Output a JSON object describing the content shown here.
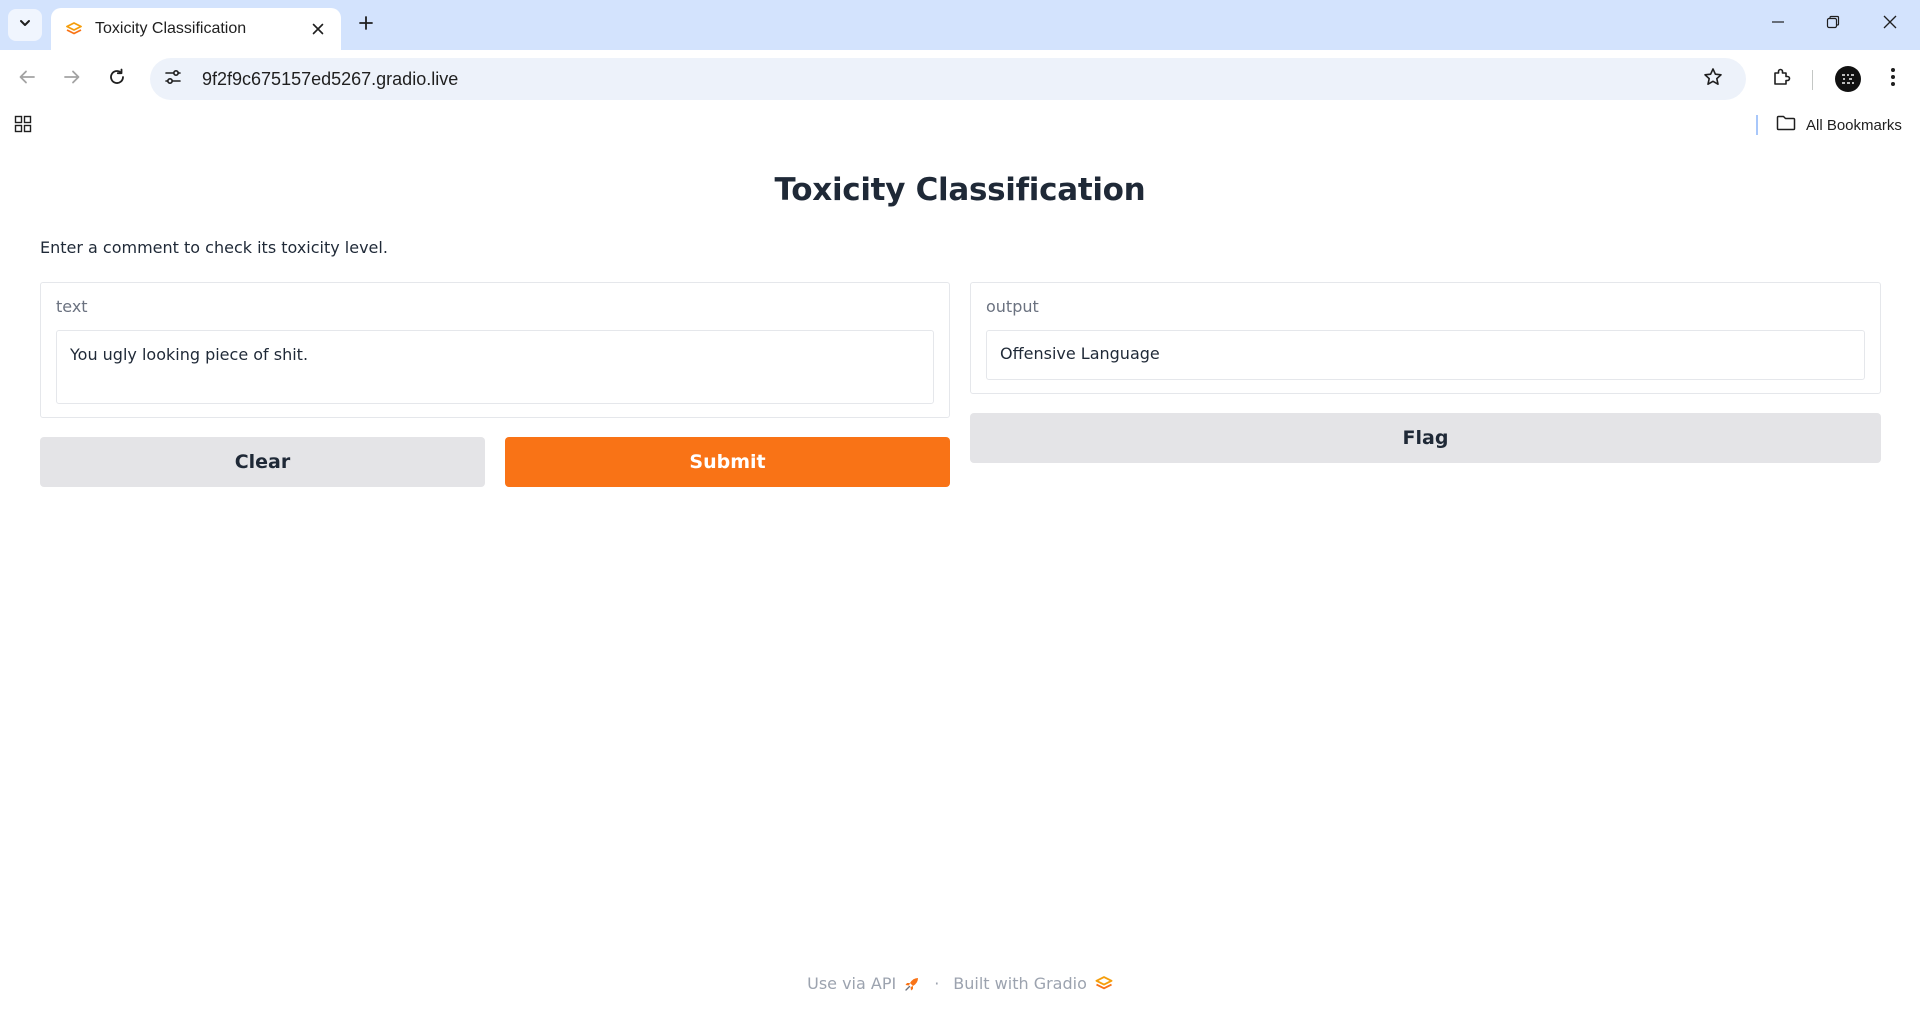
{
  "browser": {
    "tab": {
      "title": "Toxicity Classification"
    },
    "address_bar": {
      "url": "9f2f9c675157ed5267.gradio.live"
    },
    "bookmarks_bar": {
      "all_bookmarks_label": "All Bookmarks"
    }
  },
  "app": {
    "title": "Toxicity Classification",
    "description": "Enter a comment to check its toxicity level.",
    "input": {
      "label": "text",
      "value": "You ugly looking piece of shit."
    },
    "output": {
      "label": "output",
      "value": "Offensive Language"
    },
    "buttons": {
      "clear": "Clear",
      "submit": "Submit",
      "flag": "Flag"
    },
    "footer": {
      "api_label": "Use via API",
      "separator": "·",
      "built_with": "Built with Gradio"
    }
  },
  "colors": {
    "accent": "#f97316",
    "secondary_button": "#e4e4e7",
    "tabstrip": "#d3e3fd"
  },
  "icons": [
    "tab-list-icon",
    "gradio-logo-icon",
    "close-icon",
    "plus-icon",
    "minimize-icon",
    "restore-icon",
    "window-close-icon",
    "back-arrow-icon",
    "forward-arrow-icon",
    "reload-icon",
    "site-settings-icon",
    "star-icon",
    "extensions-icon",
    "profile-avatar-icon",
    "more-vert-icon",
    "apps-grid-icon",
    "folder-icon",
    "rocket-icon"
  ]
}
